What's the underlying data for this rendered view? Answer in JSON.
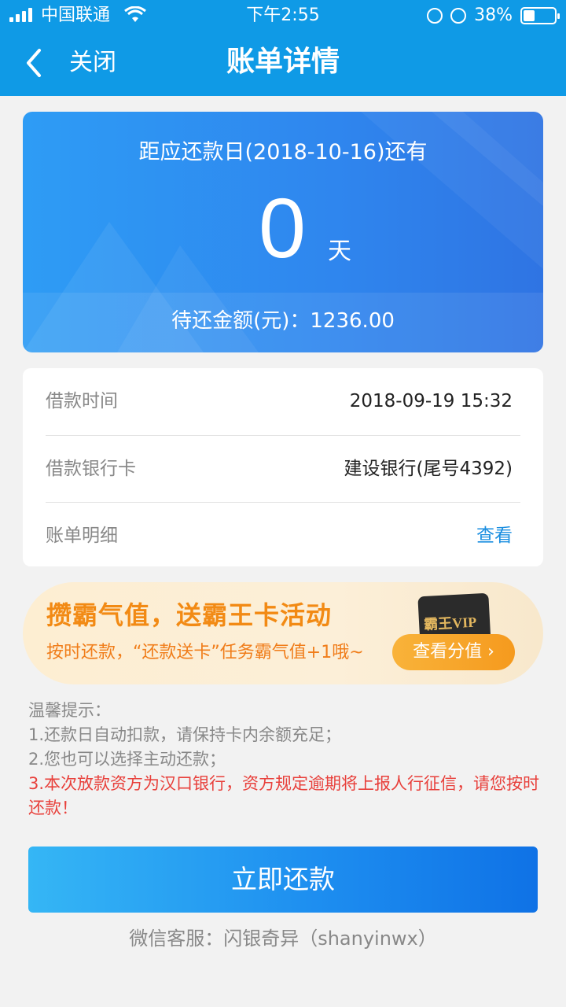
{
  "status_bar": {
    "carrier": "中国联通",
    "time": "下午2:55",
    "battery": "38%",
    "battery_level": 0.38,
    "icons": [
      "signal-icon",
      "wifi-icon",
      "orientation-lock-icon",
      "alarm-icon",
      "battery-icon"
    ]
  },
  "nav": {
    "back_icon": "chevron-left-icon",
    "close_label": "关闭",
    "title": "账单详情"
  },
  "hero": {
    "due_text": "距应还款日(2018-10-16)还有",
    "days": "0",
    "day_unit": "天",
    "amount_text": "待还金额(元)：1236.00"
  },
  "info": {
    "rows": [
      {
        "label": "借款时间",
        "value": "2018-09-19 15:32"
      },
      {
        "label": "借款银行卡",
        "value": "建设银行(尾号4392)"
      },
      {
        "label": "账单明细",
        "value": "查看"
      }
    ]
  },
  "promo": {
    "title": "攒霸气值，送霸王卡活动",
    "subtitle": "按时还款，“还款送卡”任务霸气值+1哦~",
    "button": "查看分值",
    "card_text": "霸王VIP"
  },
  "tips": {
    "heading": "温馨提示：",
    "lines": [
      "1.还款日自动扣款，请保持卡内余额充足；",
      "2.您也可以选择主动还款；"
    ],
    "warning": "3.本次放款资方为汉口银行，资方规定逾期将上报人行征信，请您按时还款！"
  },
  "pay_button": "立即还款",
  "service": "微信客服：闪银奇异（shanyinwx）",
  "colors": {
    "brand_blue": "#0f9ae6",
    "link_blue": "#1a8ee0",
    "warning_red": "#e8403b",
    "promo_orange": "#f28a14"
  }
}
